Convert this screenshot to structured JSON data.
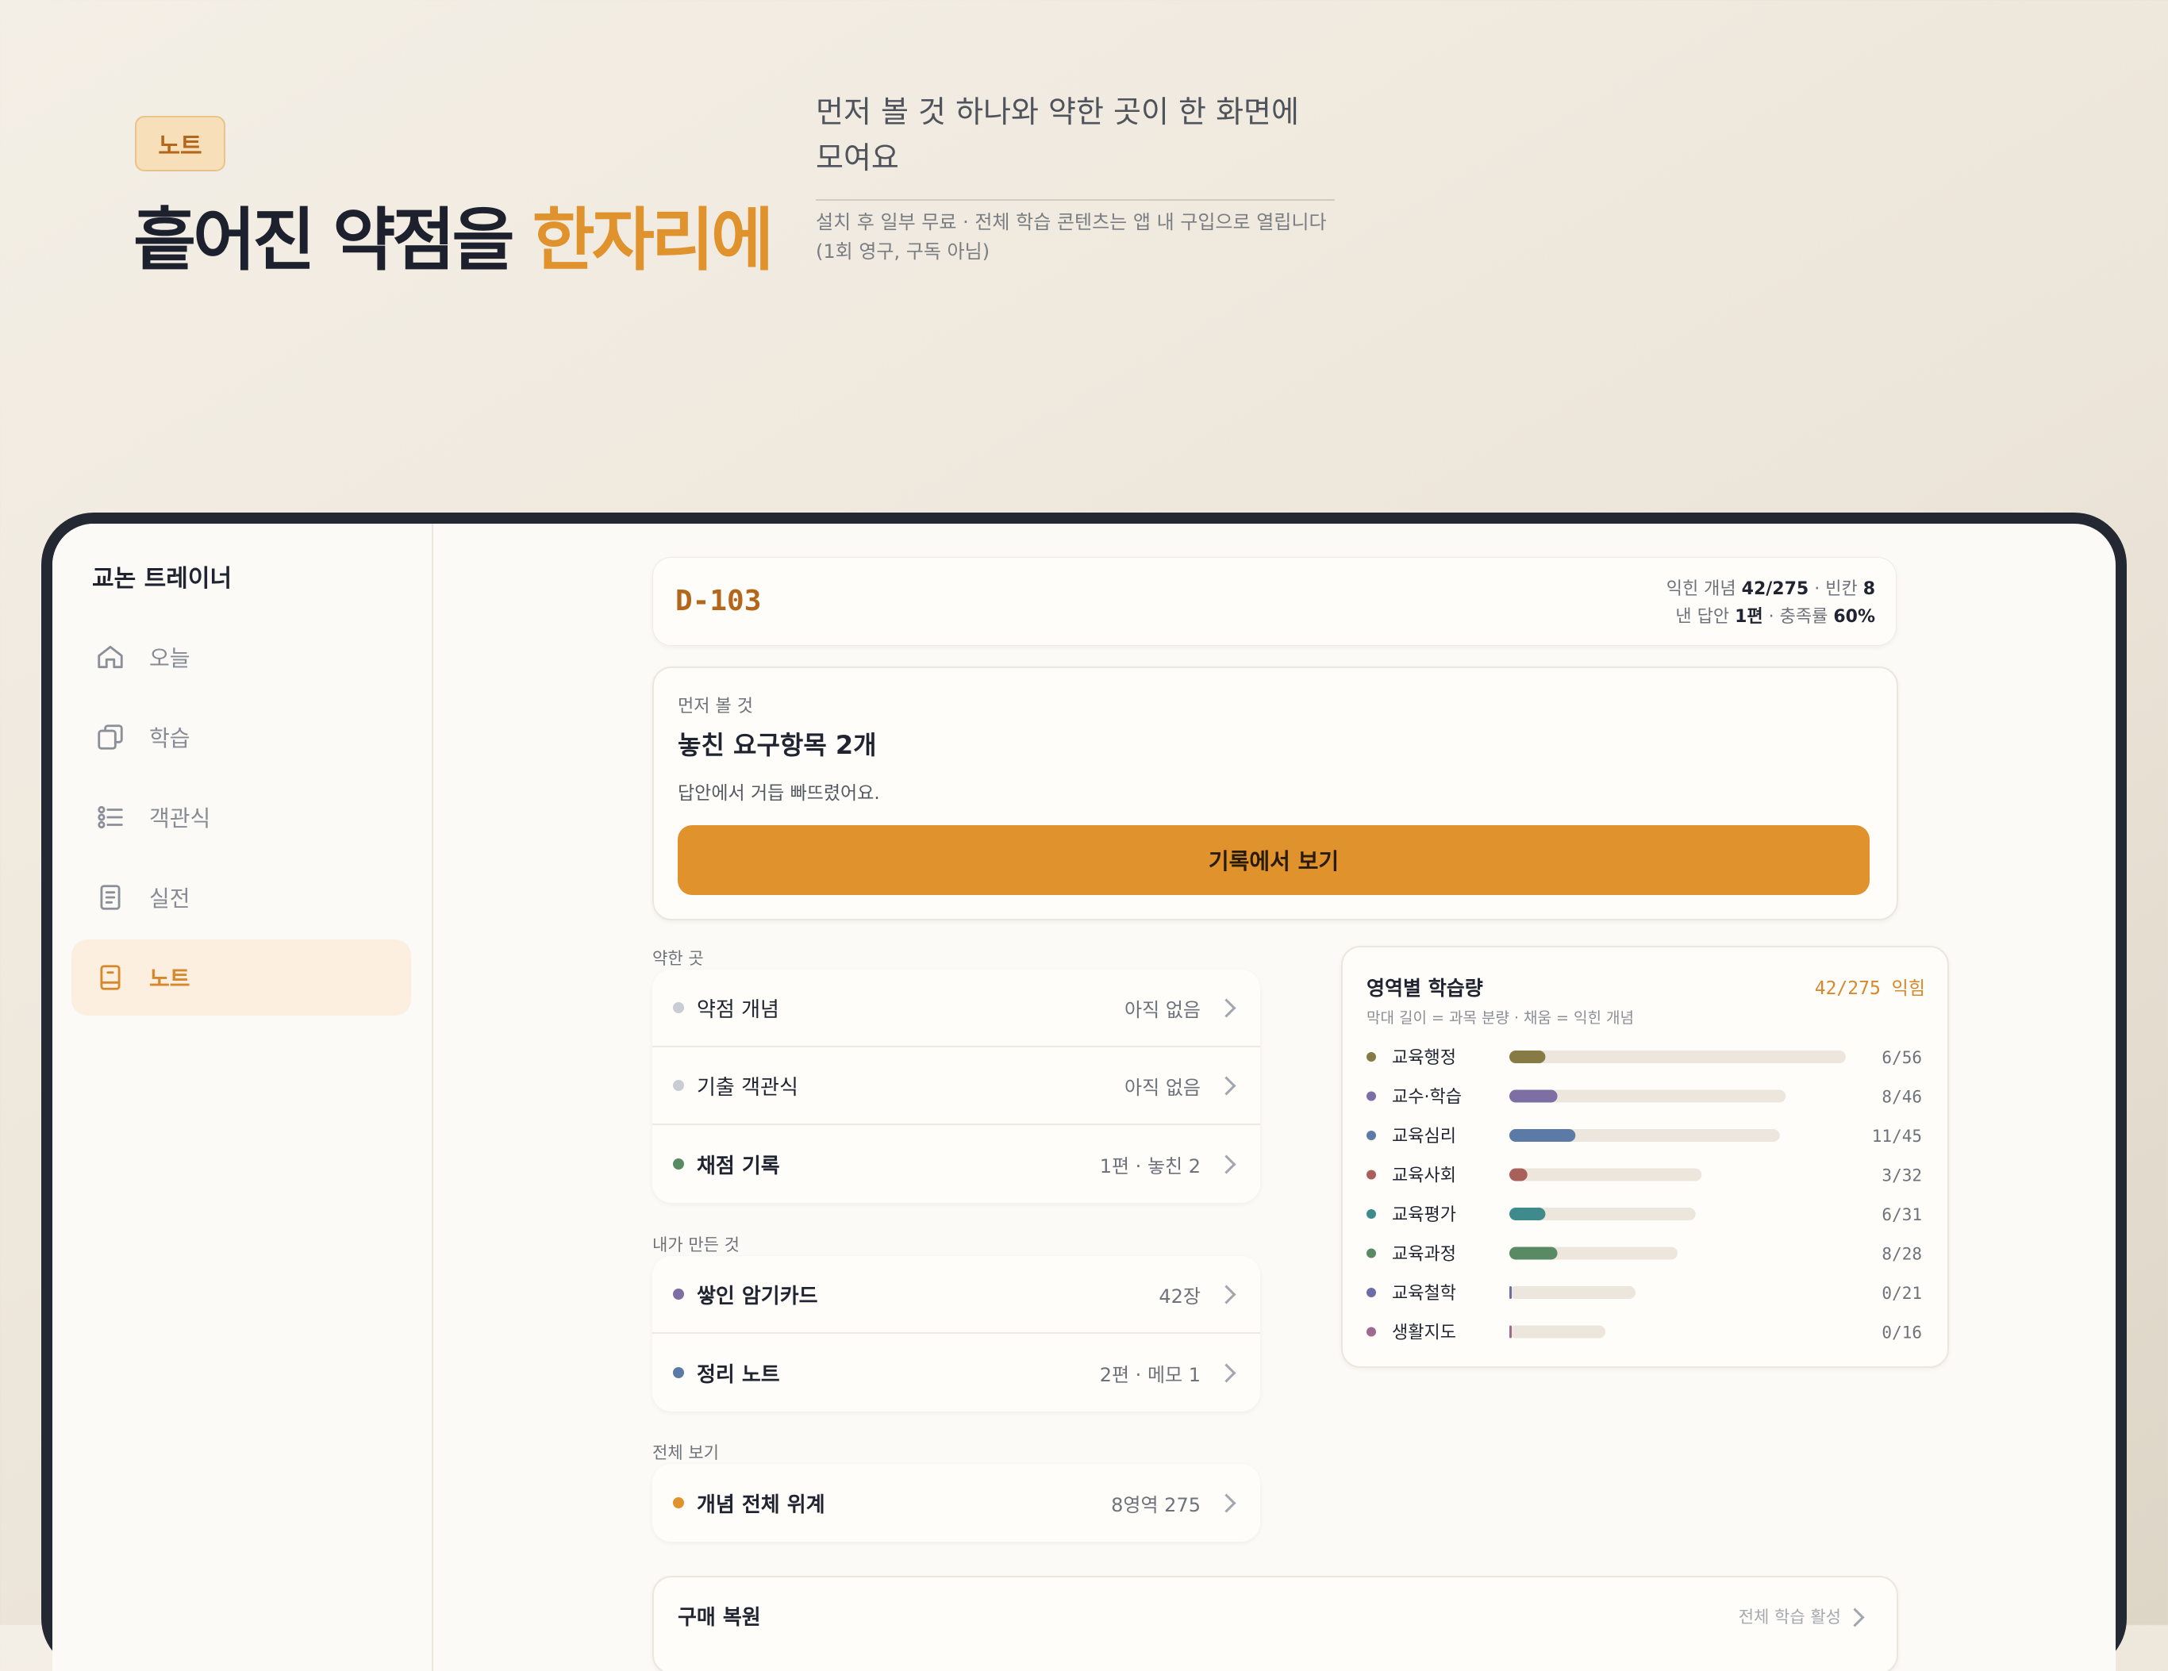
{
  "hero": {
    "badge": "노트",
    "title_main": "흩어진 약점을 ",
    "title_accent": "한자리에",
    "subtitle": "먼저 볼 것 하나와 약한 곳이 한 화면에 모여요",
    "note": "설치 후 일부 무료 · 전체 학습 콘텐츠는 앱 내 구입으로 열립니다 (1회 영구, 구독 아님)"
  },
  "app": {
    "title": "교논 트레이너"
  },
  "sidebar": {
    "items": [
      {
        "label": "오늘",
        "icon": "home-icon",
        "active": false
      },
      {
        "label": "학습",
        "icon": "cards-icon",
        "active": false
      },
      {
        "label": "객관식",
        "icon": "list-icon",
        "active": false
      },
      {
        "label": "실전",
        "icon": "document-icon",
        "active": false
      },
      {
        "label": "노트",
        "icon": "notebook-icon",
        "active": true
      }
    ]
  },
  "header": {
    "dday": "D-103",
    "stat1_prefix": "익힌 개념 ",
    "stat1_value": "42/275",
    "stat1_mid": " · 빈칸 ",
    "stat1_value2": "8",
    "stat2_prefix": "낸 답안 ",
    "stat2_value": "1편",
    "stat2_mid": " · 충족률 ",
    "stat2_value2": "60%"
  },
  "first": {
    "kicker": "먼저 볼 것",
    "title": "놓친 요구항목 2개",
    "desc": "답안에서 거듭 빠뜨렸어요.",
    "button": "기록에서 보기"
  },
  "weak": {
    "label": "약한 곳",
    "rows": [
      {
        "label": "약점 개념",
        "meta": "아직 없음",
        "dot": "#c9ccd2",
        "bold": false
      },
      {
        "label": "기출 객관식",
        "meta": "아직 없음",
        "dot": "#c9ccd2",
        "bold": false
      },
      {
        "label": "채점 기록",
        "meta": "1편 · 놓친 2",
        "dot": "#5a8a63",
        "bold": true
      }
    ]
  },
  "mine": {
    "label": "내가 만든 것",
    "rows": [
      {
        "label": "쌓인 암기카드",
        "meta": "42장",
        "dot": "#7d6ea3",
        "bold": true
      },
      {
        "label": "정리 노트",
        "meta": "2편 · 메모 1",
        "dot": "#5b7aa6",
        "bold": true
      }
    ]
  },
  "all": {
    "label": "전체 보기",
    "rows": [
      {
        "label": "개념 전체 위계",
        "meta": "8영역 275",
        "dot": "#e0922d",
        "bold": true
      }
    ]
  },
  "chart": {
    "title": "영역별 학습량",
    "total_value": "42/275",
    "total_suffix": "익힘",
    "subtitle": "막대 길이 = 과목 분량 · 채움 = 익힌 개념"
  },
  "chart_data": {
    "type": "bar",
    "orientation": "horizontal",
    "title": "영역별 학습량",
    "categories": [
      "교육행정",
      "교수·학습",
      "교육심리",
      "교육사회",
      "교육평가",
      "교육과정",
      "교육철학",
      "생활지도"
    ],
    "series": [
      {
        "name": "익힌 개념",
        "values": [
          6,
          8,
          11,
          3,
          6,
          8,
          0,
          0
        ]
      },
      {
        "name": "과목 분량",
        "values": [
          56,
          46,
          45,
          32,
          31,
          28,
          21,
          16
        ]
      }
    ],
    "labels": [
      "6/56",
      "8/46",
      "11/45",
      "3/32",
      "6/31",
      "8/28",
      "0/21",
      "0/16"
    ],
    "colors": [
      "#867a45",
      "#7d6ea3",
      "#5b7aa6",
      "#a9605a",
      "#3f8b8b",
      "#5a8a63",
      "#6b6ea6",
      "#a06a8e"
    ],
    "track_color": "#ece6dc"
  },
  "restore": {
    "label": "구매 복원",
    "status": "전체 학습 활성"
  }
}
